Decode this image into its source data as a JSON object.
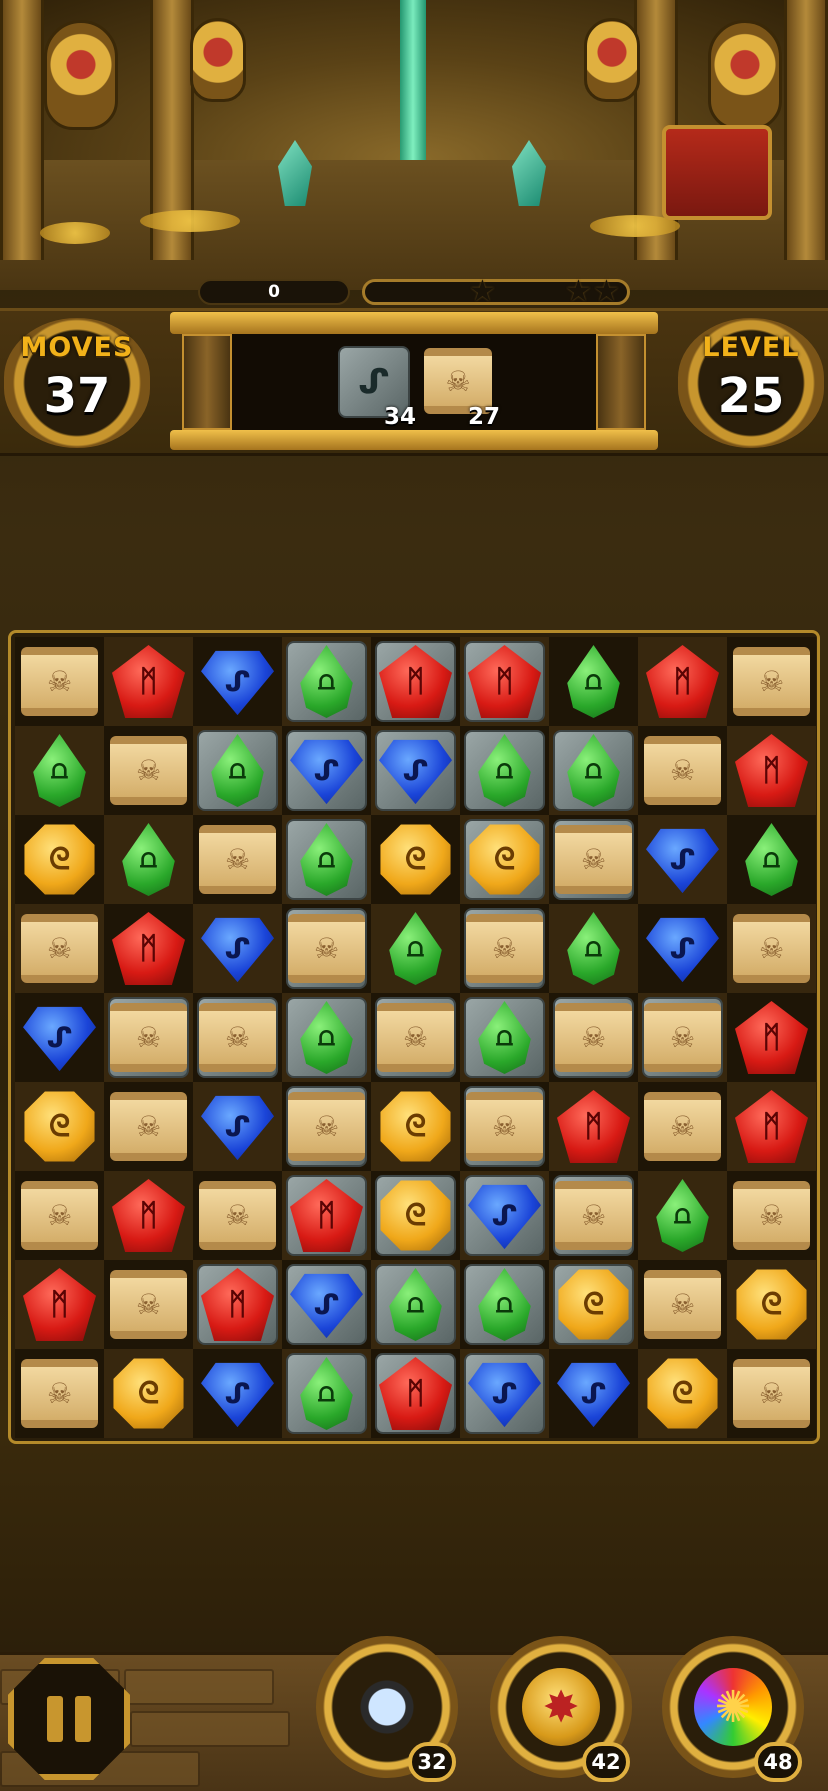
{
  "score": "0",
  "stars_total": 3,
  "moves": {
    "label": "MOVES",
    "value": "37"
  },
  "level": {
    "label": "LEVEL",
    "value": "25"
  },
  "goals": [
    {
      "icon": "stone-tile-icon",
      "count": "34"
    },
    {
      "icon": "scroll-icon",
      "count": "27"
    }
  ],
  "board": {
    "rows": [
      [
        "scroll",
        "red",
        "blue",
        "green*",
        "red*",
        "red*",
        "green",
        "red",
        "scroll"
      ],
      [
        "green",
        "scroll",
        "green*",
        "blue*",
        "blue*",
        "green*",
        "green*",
        "scroll",
        "red"
      ],
      [
        "gold",
        "green",
        "scroll",
        "green*",
        "gold",
        "gold*",
        "scroll*",
        "blue",
        "green"
      ],
      [
        "scroll",
        "red",
        "blue",
        "scroll*",
        "green",
        "scroll*",
        "green",
        "blue",
        "scroll"
      ],
      [
        "blue",
        "scroll*",
        "scroll*",
        "green*",
        "scroll*",
        "green*",
        "scroll*",
        "scroll*",
        "red"
      ],
      [
        "gold",
        "scroll",
        "blue",
        "scroll*",
        "gold",
        "scroll*",
        "red",
        "scroll",
        "red"
      ],
      [
        "scroll",
        "red",
        "scroll",
        "red*",
        "gold*",
        "blue*",
        "scroll*",
        "green",
        "scroll"
      ],
      [
        "red",
        "scroll",
        "red*",
        "blue*",
        "green*",
        "green*",
        "gold*",
        "scroll",
        "gold"
      ],
      [
        "scroll",
        "gold",
        "blue",
        "green*",
        "red*",
        "blue*",
        "blue",
        "gold",
        "scroll"
      ]
    ],
    "legend": "* = gem sits on a stone tile"
  },
  "gem_symbols": {
    "red": "ᛗ",
    "blue": "ᔑ",
    "green": "⩍",
    "gold": "ᘓ",
    "scroll": "☠"
  },
  "boosters": [
    {
      "icon": "magnifier-icon",
      "count": "32"
    },
    {
      "icon": "bomb-icon",
      "count": "42"
    },
    {
      "icon": "rainbow-orb-icon",
      "count": "48"
    }
  ],
  "colors": {
    "accent_gold": "#f2b21a",
    "frame_gold": "#c8962e",
    "beam": "#1ea07a"
  }
}
